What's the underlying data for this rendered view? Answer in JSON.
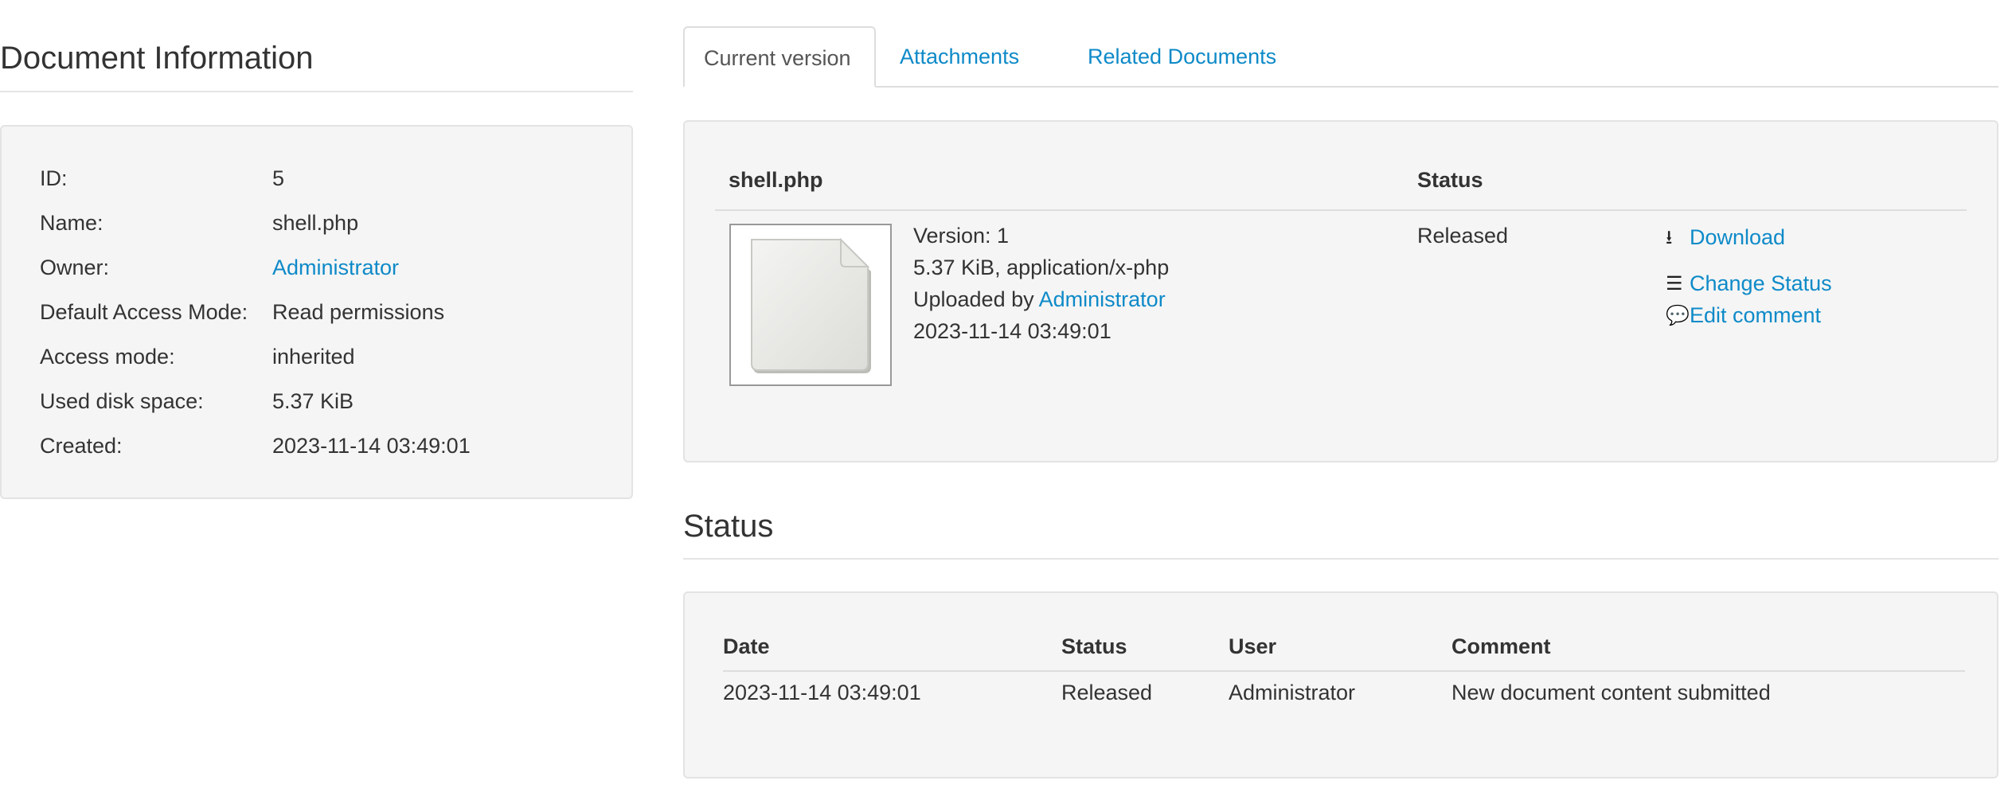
{
  "document_info": {
    "title": "Document Information",
    "rows": [
      {
        "label": "ID:",
        "value": "5"
      },
      {
        "label": "Name:",
        "value": "shell.php"
      },
      {
        "label": "Owner:",
        "value": "Administrator"
      },
      {
        "label": "Default Access Mode:",
        "value": "Read permissions"
      },
      {
        "label": "Access mode:",
        "value": "inherited"
      },
      {
        "label": "Used disk space:",
        "value": "5.37 KiB"
      },
      {
        "label": "Created:",
        "value": "2023-11-14 03:49:01"
      }
    ]
  },
  "tabs": [
    {
      "label": "Current version",
      "active": true
    },
    {
      "label": "Attachments",
      "active": false
    },
    {
      "label": "Related Documents",
      "active": false
    }
  ],
  "current_version": {
    "col_file": "shell.php",
    "col_status": "Status",
    "version_line": "Version: 1",
    "size_line": "5.37 KiB, application/x-php",
    "uploaded_prefix": "Uploaded by",
    "uploaded_by": "Administrator",
    "date": "2023-11-14 03:49:01",
    "status": "Released",
    "actions": {
      "download": "Download",
      "change_status": "Change Status",
      "edit_comment": "Edit comment"
    },
    "thumbnail_icon": "document-file-icon"
  },
  "status_section": {
    "title": "Status",
    "headers": {
      "date": "Date",
      "status": "Status",
      "user": "User",
      "comment": "Comment"
    },
    "rows": [
      {
        "date": "2023-11-14 03:49:01",
        "status": "Released",
        "user": "Administrator",
        "comment": "New document content submitted"
      }
    ]
  },
  "colors": {
    "link": "#0e8ac8",
    "well_bg": "#f5f5f5",
    "well_border": "#e3e3e3"
  }
}
